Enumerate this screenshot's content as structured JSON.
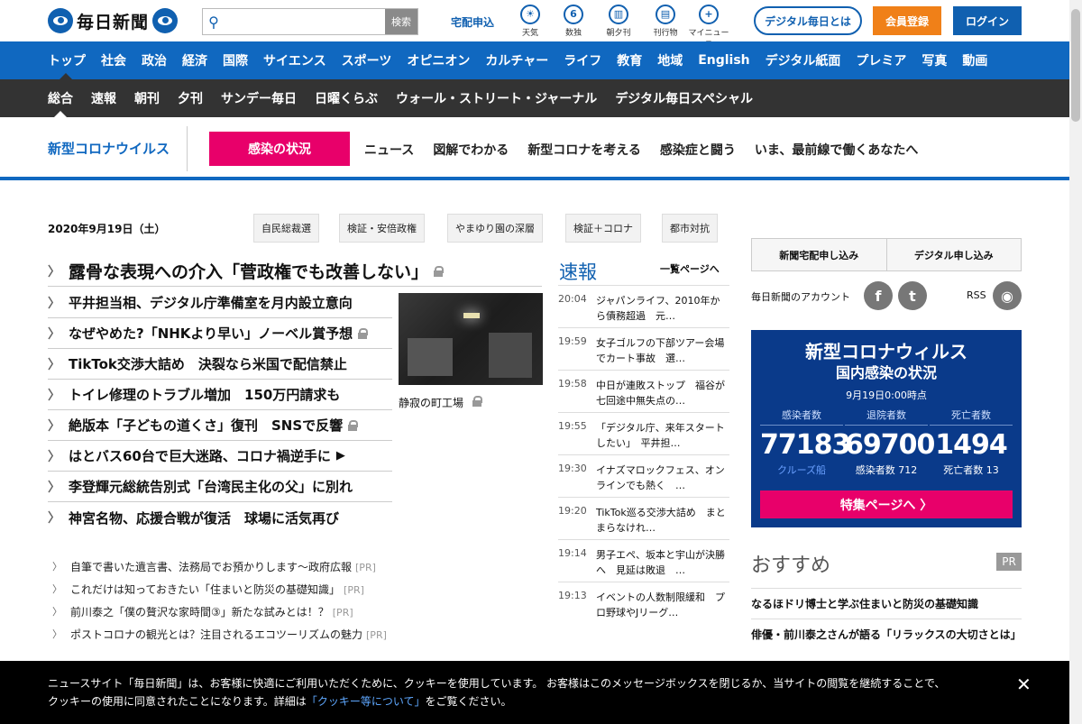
{
  "header": {
    "logo_text": "毎日新聞",
    "search_placeholder": "",
    "search_button": "検索",
    "delivery": "宅配申込",
    "tools": [
      {
        "label": "天気",
        "icon": "weather-icon",
        "glyph": "☀"
      },
      {
        "label": "数独",
        "icon": "sudoku-icon",
        "glyph": "6"
      },
      {
        "label": "朝夕刊",
        "icon": "newspaper-icon",
        "glyph": "▥"
      },
      {
        "label": "刊行物",
        "icon": "book-icon",
        "glyph": "▤"
      },
      {
        "label": "マイニュース",
        "icon": "mynews-icon",
        "glyph": "+"
      }
    ],
    "digital_button": "デジタル毎日とは",
    "register_button": "会員登録",
    "login_button": "ログイン"
  },
  "nav_primary": [
    "トップ",
    "社会",
    "政治",
    "経済",
    "国際",
    "サイエンス",
    "スポーツ",
    "オピニオン",
    "カルチャー",
    "ライフ",
    "教育",
    "地域",
    "English",
    "デジタル紙面",
    "プレミア",
    "写真",
    "動画"
  ],
  "nav_secondary": [
    "総合",
    "速報",
    "朝刊",
    "夕刊",
    "サンデー毎日",
    "日曜くらぶ",
    "ウォール・ストリート・ジャーナル",
    "デジタル毎日スペシャル"
  ],
  "corona_bar": {
    "title": "新型コロナウイルス",
    "status_button": "感染の状況",
    "links": [
      "ニュース",
      "図解でわかる",
      "新型コロナを考える",
      "感染症と闘う",
      "いま、最前線で働くあなたへ"
    ]
  },
  "date": "2020年9月19日（土）",
  "tags": [
    "自民総裁選",
    "検証・安倍政権",
    "やまゆり園の深層",
    "検証＋コロナ",
    "都市対抗"
  ],
  "top_headline": "露骨な表現への介入「菅政権でも改善しない」",
  "headlines": [
    {
      "text": "平井担当相、デジタル庁準備室を月内設立意向",
      "lock": false,
      "video": false
    },
    {
      "text": "なぜやめた?「NHKより早い」ノーベル賞予想",
      "lock": true,
      "video": false
    },
    {
      "text": "TikTok交渉大詰め　決裂なら米国で配信禁止",
      "lock": false,
      "video": false
    },
    {
      "text": "トイレ修理のトラブル増加　150万円請求も",
      "lock": false,
      "video": false
    },
    {
      "text": "絶版本「子どもの道くさ」復刊　SNSで反響",
      "lock": true,
      "video": false
    },
    {
      "text": "はとバス60台で巨大迷路、コロナ禍逆手に",
      "lock": false,
      "video": true
    },
    {
      "text": "李登輝元総統告別式「台湾民主化の父」に別れ",
      "lock": false,
      "video": false
    },
    {
      "text": "神宮名物、応援合戦が復活　球場に活気再び",
      "lock": false,
      "video": false
    }
  ],
  "photo_caption": "静寂の町工場",
  "pr_items": [
    {
      "text": "自筆で書いた遺言書、法務局でお預かりします～政府広報",
      "tag": "[PR]"
    },
    {
      "text": "これだけは知っておきたい「住まいと防災の基礎知識」",
      "tag": "[PR]"
    },
    {
      "text": "前川泰之「僕の贅沢な家時間③」新たな試みとは！？",
      "tag": "[PR]"
    },
    {
      "text": "ポストコロナの観光とは？注目されるエコツーリズムの魅力",
      "tag": "[PR]"
    }
  ],
  "breaking": {
    "title": "速報",
    "all_link": "一覧ページへ",
    "items": [
      {
        "time": "20:04",
        "text": "ジャパンライフ、2010年から債務超過　元…"
      },
      {
        "time": "19:59",
        "text": "女子ゴルフの下部ツアー会場でカート事故　選…"
      },
      {
        "time": "19:58",
        "text": "中日が連敗ストップ　福谷が七回途中無失点の…"
      },
      {
        "time": "19:55",
        "text": "「デジタル庁、来年スタートしたい」　平井担…"
      },
      {
        "time": "19:30",
        "text": "イナズマロックフェス、オンラインでも熱く　…"
      },
      {
        "time": "19:20",
        "text": "TikTok巡る交渉大詰め　まとまらなけれ…"
      },
      {
        "time": "19:14",
        "text": "男子エペ、坂本と宇山が決勝へ　見延は敗退　…"
      },
      {
        "time": "19:13",
        "text": "イベントの人数制限緩和　プロ野球やJリーグ…"
      }
    ]
  },
  "sidebar": {
    "subscribe_paper": "新聞宅配申し込み",
    "subscribe_digital": "デジタル申し込み",
    "accounts_label": "毎日新聞のアカウント",
    "rss": "RSS",
    "corona_box": {
      "title": "新型コロナウィルス",
      "subtitle": "国内感染の状況",
      "as_of": "9月19日0:00時点",
      "infected_label": "感染者数",
      "infected": "77183",
      "infected_sub": "クルーズ船",
      "recovered_label": "退院者数",
      "recovered": "69700",
      "recovered_sub": "感染者数 712",
      "deaths_label": "死亡者数",
      "deaths": "1494",
      "deaths_sub": "死亡者数 13",
      "special_button": "特集ページへ"
    },
    "recommend_title": "おすすめ",
    "recommend_pr": "PR",
    "recommend": [
      "なるほドリ博士と学ぶ住まいと防災の基礎知識",
      "俳優・前川泰之さんが語る「リラックスの大切さとは」"
    ]
  },
  "cookie": {
    "text_before": "ニュースサイト「毎日新聞」は、お客様に快適にご利用いただくために、クッキーを使用しています。 お客様はこのメッセージボックスを閉じるか、当サイトの閲覧を継続することで、クッキーの使用に同意されたことになります。詳細は",
    "link": "「クッキー等について」",
    "text_after": "をご覧ください。",
    "close": "✕"
  },
  "colors": {
    "brand_blue": "#1068c0",
    "pink": "#e8006a",
    "orange": "#f08018",
    "dark_nav": "#333333",
    "corona_box": "#0a3a8a"
  }
}
